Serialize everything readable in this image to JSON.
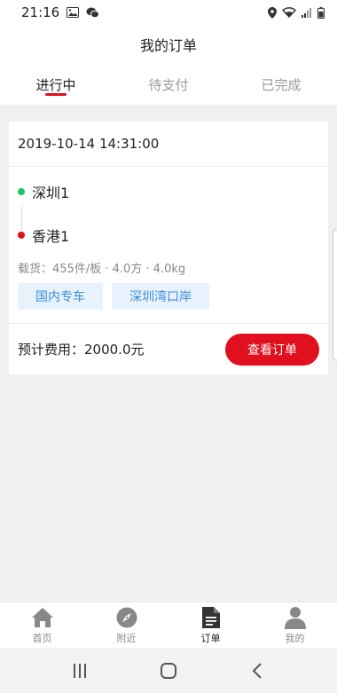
{
  "status_bar": {
    "time": "21:16",
    "icons": [
      "image-icon",
      "wechat-icon",
      "location-icon",
      "wifi-icon",
      "signal-icon",
      "battery-icon"
    ]
  },
  "header": {
    "title": "我的订单"
  },
  "tabs": [
    {
      "label": "进行中",
      "active": true
    },
    {
      "label": "待支付",
      "active": false
    },
    {
      "label": "已完成",
      "active": false
    }
  ],
  "order": {
    "time": "2019-10-14 14:31:00",
    "from": "深圳1",
    "to": "香港1",
    "cargo": "载货：455件/板 · 4.0方 · 4.0kg",
    "tags": [
      "国内专车",
      "深圳湾口岸"
    ],
    "fee": "预计费用：2000.0元",
    "view_button": "查看订单"
  },
  "bottom_nav": [
    {
      "label": "首页",
      "icon": "home-icon",
      "active": false
    },
    {
      "label": "附近",
      "icon": "compass-icon",
      "active": false
    },
    {
      "label": "订单",
      "icon": "document-icon",
      "active": true
    },
    {
      "label": "我的",
      "icon": "user-icon",
      "active": false
    }
  ],
  "colors": {
    "accent": "#e0101e",
    "from_dot": "#1ec36a",
    "to_dot": "#e0101e",
    "tag_bg": "#e8f2fc",
    "tag_text": "#3b8de0",
    "page_bg": "#eef0f2"
  }
}
